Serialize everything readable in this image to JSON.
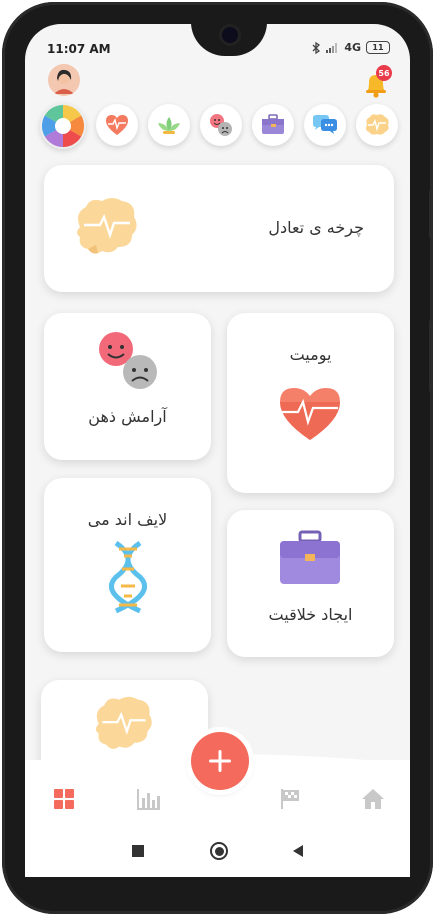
{
  "status_bar": {
    "time": "11:07 AM",
    "network": "4G",
    "battery": "11"
  },
  "header": {
    "notification_count": "56"
  },
  "categories": [
    {
      "icon": "color-wheel-icon",
      "selected": true
    },
    {
      "icon": "heart-pulse-icon"
    },
    {
      "icon": "lotus-icon"
    },
    {
      "icon": "emotion-faces-icon"
    },
    {
      "icon": "briefcase-icon"
    },
    {
      "icon": "chat-bubbles-icon"
    },
    {
      "icon": "brain-icon"
    }
  ],
  "cards": {
    "balance_wheel": "چرخه ی تعادل",
    "diary": "یومیت",
    "peace_of_mind": "آرامش ذهن",
    "life_and_me": "لایف اند می",
    "creativity": "ایجاد خلاقیت"
  },
  "bottom_nav": [
    {
      "icon": "grid-icon",
      "active": true
    },
    {
      "icon": "bar-chart-icon"
    },
    {
      "icon": "plus-icon"
    },
    {
      "icon": "flag-icon"
    },
    {
      "icon": "home-icon"
    }
  ],
  "colors": {
    "accent": "#f46a5c",
    "background": "#f5f5f5",
    "card": "#ffffff"
  }
}
